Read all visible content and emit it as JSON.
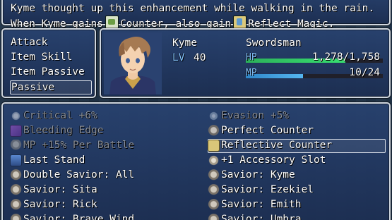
{
  "help": {
    "line1": "Kyme thought up this enhancement while walking in the rain.",
    "line2_prefix": "When Kyme gains",
    "line2_state1": "Counter,",
    "line2_middle": "also gain",
    "line2_state2": "Reflect Magic."
  },
  "categories": [
    {
      "label": "Attack"
    },
    {
      "label": "Item Skill"
    },
    {
      "label": "Item Passive"
    },
    {
      "label": "Passive"
    }
  ],
  "actor": {
    "name": "Kyme",
    "class": "Swordsman",
    "level_label": "LV",
    "level": "40",
    "hp_label": "HP",
    "hp_text": "1,278/1,758",
    "hp_ratio": 0.727,
    "mp_label": "MP",
    "mp_text": "10/24",
    "mp_ratio": 0.417
  },
  "colors": {
    "system_text": "#84c4ff",
    "hp_gauge": "#38e070",
    "mp_gauge": "#55b6f0"
  },
  "passives_left": [
    {
      "label": "Critical +6%",
      "icon": "sparkle-icon",
      "dim": true
    },
    {
      "label": "Bleeding Edge",
      "icon": "bleeding-edge-icon",
      "dim": true
    },
    {
      "label": "MP +15% Per Battle",
      "icon": "mp-regen-icon",
      "dim": true
    },
    {
      "label": "Last Stand",
      "icon": "last-stand-icon",
      "dim": false
    },
    {
      "label": "Double Savior: All",
      "icon": "savior-icon",
      "dim": false
    },
    {
      "label": "Savior: Sita",
      "icon": "savior-icon",
      "dim": false
    },
    {
      "label": "Savior: Rick",
      "icon": "savior-icon",
      "dim": false
    },
    {
      "label": "Savior: Brave Wind",
      "icon": "savior-icon",
      "dim": false
    }
  ],
  "passives_right": [
    {
      "label": "Evasion +5%",
      "icon": "evasion-icon",
      "dim": true
    },
    {
      "label": "Perfect Counter",
      "icon": "counter-icon",
      "dim": false
    },
    {
      "label": "Reflective Counter",
      "icon": "reflect-counter-icon",
      "dim": false,
      "selected": true
    },
    {
      "label": "+1 Accessory Slot",
      "icon": "accessory-icon",
      "dim": false
    },
    {
      "label": "Savior: Kyme",
      "icon": "savior-icon",
      "dim": false
    },
    {
      "label": "Savior: Ezekiel",
      "icon": "savior-icon",
      "dim": false
    },
    {
      "label": "Savior: Emith",
      "icon": "savior-icon",
      "dim": false
    },
    {
      "label": "Savior: Umbra",
      "icon": "savior-icon",
      "dim": false
    }
  ]
}
